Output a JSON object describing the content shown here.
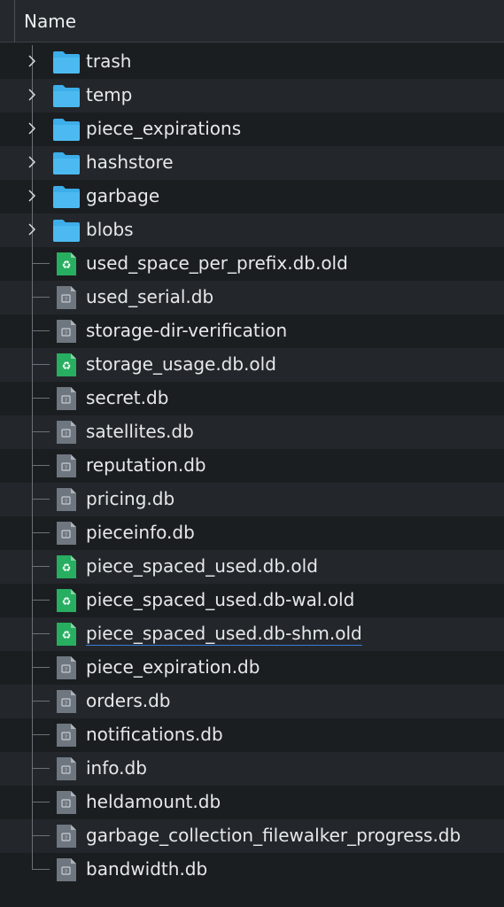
{
  "header": {
    "column_name": "Name"
  },
  "items": [
    {
      "name": "trash",
      "type": "folder"
    },
    {
      "name": "temp",
      "type": "folder"
    },
    {
      "name": "piece_expirations",
      "type": "folder"
    },
    {
      "name": "hashstore",
      "type": "folder"
    },
    {
      "name": "garbage",
      "type": "folder"
    },
    {
      "name": "blobs",
      "type": "folder"
    },
    {
      "name": "used_space_per_prefix.db.old",
      "type": "recycle-file"
    },
    {
      "name": "used_serial.db",
      "type": "unknown-file"
    },
    {
      "name": "storage-dir-verification",
      "type": "unknown-file"
    },
    {
      "name": "storage_usage.db.old",
      "type": "recycle-file"
    },
    {
      "name": "secret.db",
      "type": "unknown-file"
    },
    {
      "name": "satellites.db",
      "type": "unknown-file"
    },
    {
      "name": "reputation.db",
      "type": "unknown-file"
    },
    {
      "name": "pricing.db",
      "type": "unknown-file"
    },
    {
      "name": "pieceinfo.db",
      "type": "unknown-file"
    },
    {
      "name": "piece_spaced_used.db.old",
      "type": "recycle-file"
    },
    {
      "name": "piece_spaced_used.db-wal.old",
      "type": "recycle-file"
    },
    {
      "name": "piece_spaced_used.db-shm.old",
      "type": "recycle-file",
      "underlined": true
    },
    {
      "name": "piece_expiration.db",
      "type": "unknown-file"
    },
    {
      "name": "orders.db",
      "type": "unknown-file"
    },
    {
      "name": "notifications.db",
      "type": "unknown-file"
    },
    {
      "name": "info.db",
      "type": "unknown-file"
    },
    {
      "name": "heldamount.db",
      "type": "unknown-file"
    },
    {
      "name": "garbage_collection_filewalker_progress.db",
      "type": "unknown-file"
    },
    {
      "name": "bandwidth.db",
      "type": "unknown-file"
    }
  ],
  "colors": {
    "folder": "#3daee9",
    "recycle_file": "#27ae60",
    "unknown_file": "#6e7680",
    "row_alt": "#23272b",
    "background": "#1b1e20"
  }
}
